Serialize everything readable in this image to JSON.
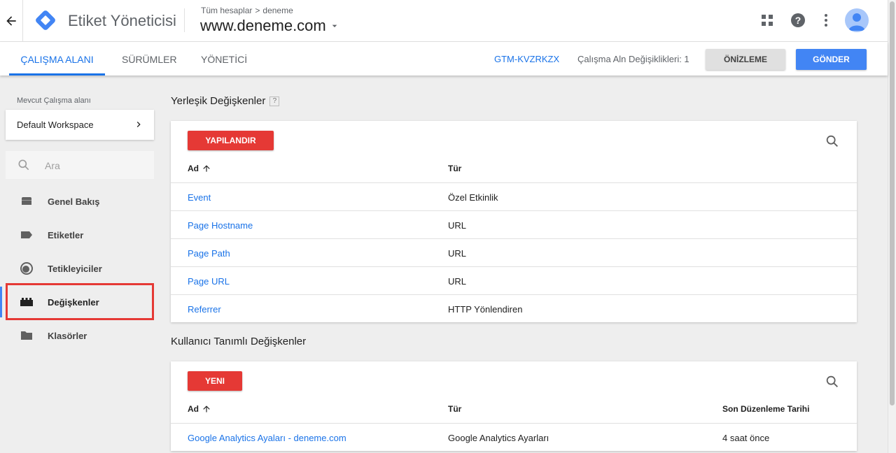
{
  "header": {
    "back_icon": "arrow-left-icon",
    "app_title": "Etiket Yöneticisi",
    "breadcrumb": {
      "root": "Tüm hesaplar",
      "separator": ">",
      "account": "deneme"
    },
    "container_name": "www.deneme.com",
    "icons": [
      "apps-grid-icon",
      "help-icon",
      "more-vert-icon",
      "account-avatar-icon"
    ]
  },
  "tabs": [
    {
      "label": "ÇALIŞMA ALANI",
      "active": true
    },
    {
      "label": "SÜRÜMLER",
      "active": false
    },
    {
      "label": "YÖNETİCİ",
      "active": false
    }
  ],
  "toolbar": {
    "container_id": "GTM-KVZRKZX",
    "workspace_changes": "Çalışma Aln Değişiklikleri: 1",
    "preview_label": "ÖNİZLEME",
    "submit_label": "GÖNDER"
  },
  "sidebar": {
    "workspace_label": "Mevcut Çalışma alanı",
    "workspace_name": "Default Workspace",
    "search_placeholder": "Ara",
    "items": [
      {
        "label": "Genel Bakış",
        "icon": "overview-icon",
        "active": false
      },
      {
        "label": "Etiketler",
        "icon": "tag-icon",
        "active": false
      },
      {
        "label": "Tetikleyiciler",
        "icon": "trigger-icon",
        "active": false
      },
      {
        "label": "Değişkenler",
        "icon": "variables-icon",
        "active": true
      },
      {
        "label": "Klasörler",
        "icon": "folder-icon",
        "active": false
      }
    ]
  },
  "builtin": {
    "title": "Yerleşik Değişkenler",
    "help": "?",
    "button": "YAPILANDIR",
    "columns": {
      "name": "Ad",
      "type": "Tür"
    },
    "rows": [
      {
        "name": "Event",
        "type": "Özel Etkinlik"
      },
      {
        "name": "Page Hostname",
        "type": "URL"
      },
      {
        "name": "Page Path",
        "type": "URL"
      },
      {
        "name": "Page URL",
        "type": "URL"
      },
      {
        "name": "Referrer",
        "type": "HTTP Yönlendiren"
      }
    ]
  },
  "user_defined": {
    "title": "Kullanıcı Tanımlı Değişkenler",
    "button": "YENI",
    "columns": {
      "name": "Ad",
      "type": "Tür",
      "edited": "Son Düzenleme Tarihi"
    },
    "rows": [
      {
        "name": "Google Analytics Ayaları - deneme.com",
        "type": "Google Analytics Ayarları",
        "edited": "4 saat önce"
      }
    ]
  },
  "colors": {
    "accent": "#1a73e8",
    "primary_button": "#4285f4",
    "red_button": "#e53935",
    "gtm_logo_blue": "#4285f4"
  }
}
